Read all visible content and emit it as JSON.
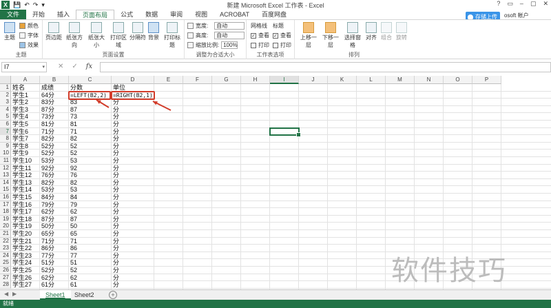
{
  "window": {
    "title": "新建 Microsoft Excel 工作表 - Excel",
    "controls": [
      "?",
      "▭",
      "–",
      "▢",
      "✕"
    ]
  },
  "tabs": [
    "文件",
    "开始",
    "插入",
    "页面布局",
    "公式",
    "数据",
    "审阅",
    "视图",
    "ACROBAT",
    "百度网盘"
  ],
  "upload_label": "存储上传",
  "account": "osoft 帐户",
  "ribbon": {
    "theme": {
      "label": "主题",
      "items": [
        "颜色",
        "字体",
        "效果"
      ],
      "main": "主题"
    },
    "page_setup": {
      "label": "页面设置",
      "buttons": [
        "页边距",
        "纸张方向",
        "纸张大小",
        "打印区域",
        "分隔符",
        "背景",
        "打印标题"
      ]
    },
    "scale": {
      "label": "调整为合适大小",
      "width_label": "宽度:",
      "width_value": "自动",
      "height_label": "高度:",
      "height_value": "自动",
      "zoom_label": "缩放比例:",
      "zoom_value": "100%"
    },
    "sheet_options": {
      "label": "工作表选项",
      "gridlines": "网格线",
      "headings": "标题",
      "view": "查看",
      "print": "打印"
    },
    "arrange": {
      "label": "排列",
      "buttons": [
        "上移一层",
        "下移一层",
        "选择窗格",
        "对齐",
        "组合",
        "旋转"
      ]
    }
  },
  "formula_bar": {
    "name_box": "I7",
    "formula": "",
    "fx": "fx"
  },
  "columns": [
    "A",
    "B",
    "C",
    "D",
    "E",
    "F",
    "G",
    "H",
    "I",
    "J",
    "K",
    "L",
    "M",
    "N",
    "O",
    "P"
  ],
  "selected_column": "I",
  "selected_row": "7",
  "rows": [
    {
      "n": "1",
      "a": "姓名",
      "b": "成绩",
      "c": "分数",
      "d": "单位"
    },
    {
      "n": "2",
      "a": "学生1",
      "b": "64分",
      "c": "=LEFT(B2,2)",
      "d": "=RIGHT(B2,1)"
    },
    {
      "n": "3",
      "a": "学生2",
      "b": "83分",
      "c": "83",
      "d": "分"
    },
    {
      "n": "4",
      "a": "学生3",
      "b": "87分",
      "c": "87",
      "d": "分"
    },
    {
      "n": "5",
      "a": "学生4",
      "b": "73分",
      "c": "73",
      "d": "分"
    },
    {
      "n": "6",
      "a": "学生5",
      "b": "81分",
      "c": "81",
      "d": "分"
    },
    {
      "n": "7",
      "a": "学生6",
      "b": "71分",
      "c": "71",
      "d": "分"
    },
    {
      "n": "8",
      "a": "学生7",
      "b": "82分",
      "c": "82",
      "d": "分"
    },
    {
      "n": "9",
      "a": "学生8",
      "b": "52分",
      "c": "52",
      "d": "分"
    },
    {
      "n": "10",
      "a": "学生9",
      "b": "52分",
      "c": "52",
      "d": "分"
    },
    {
      "n": "11",
      "a": "学生10",
      "b": "53分",
      "c": "53",
      "d": "分"
    },
    {
      "n": "12",
      "a": "学生11",
      "b": "92分",
      "c": "92",
      "d": "分"
    },
    {
      "n": "13",
      "a": "学生12",
      "b": "76分",
      "c": "76",
      "d": "分"
    },
    {
      "n": "14",
      "a": "学生13",
      "b": "82分",
      "c": "82",
      "d": "分"
    },
    {
      "n": "15",
      "a": "学生14",
      "b": "53分",
      "c": "53",
      "d": "分"
    },
    {
      "n": "16",
      "a": "学生15",
      "b": "84分",
      "c": "84",
      "d": "分"
    },
    {
      "n": "17",
      "a": "学生16",
      "b": "79分",
      "c": "79",
      "d": "分"
    },
    {
      "n": "18",
      "a": "学生17",
      "b": "62分",
      "c": "62",
      "d": "分"
    },
    {
      "n": "19",
      "a": "学生18",
      "b": "87分",
      "c": "87",
      "d": "分"
    },
    {
      "n": "20",
      "a": "学生19",
      "b": "50分",
      "c": "50",
      "d": "分"
    },
    {
      "n": "21",
      "a": "学生20",
      "b": "65分",
      "c": "65",
      "d": "分"
    },
    {
      "n": "22",
      "a": "学生21",
      "b": "71分",
      "c": "71",
      "d": "分"
    },
    {
      "n": "23",
      "a": "学生22",
      "b": "86分",
      "c": "86",
      "d": "分"
    },
    {
      "n": "24",
      "a": "学生23",
      "b": "77分",
      "c": "77",
      "d": "分"
    },
    {
      "n": "25",
      "a": "学生24",
      "b": "51分",
      "c": "51",
      "d": "分"
    },
    {
      "n": "26",
      "a": "学生25",
      "b": "52分",
      "c": "52",
      "d": "分"
    },
    {
      "n": "27",
      "a": "学生26",
      "b": "62分",
      "c": "62",
      "d": "分"
    },
    {
      "n": "28",
      "a": "学生27",
      "b": "61分",
      "c": "61",
      "d": "分"
    }
  ],
  "sheets": [
    {
      "name": "Sheet1",
      "active": true
    },
    {
      "name": "Sheet2",
      "active": false
    }
  ],
  "status": "就绪",
  "watermark": "软件技巧",
  "colors": {
    "excel_green": "#217346",
    "highlight_red": "#d23c2a",
    "upload_blue": "#3a94e8"
  }
}
